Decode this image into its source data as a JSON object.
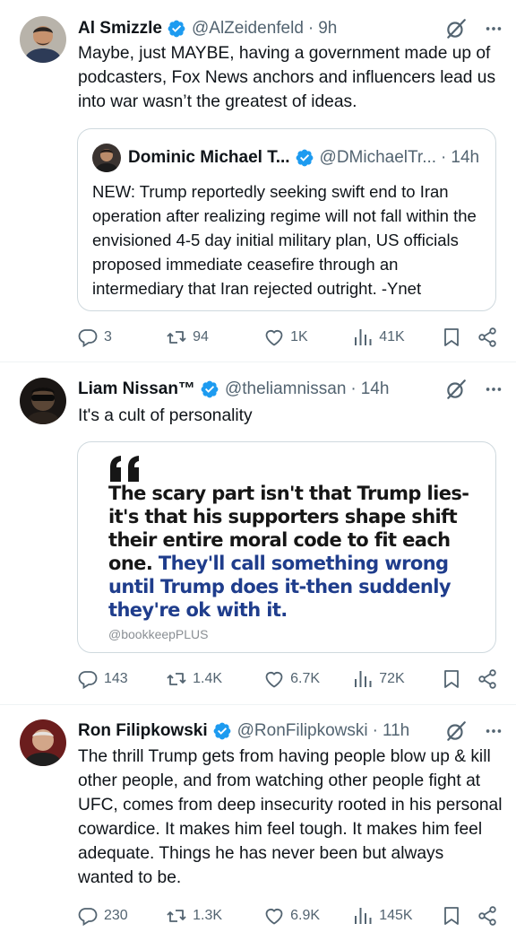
{
  "tweets": [
    {
      "name": "Al Smizzle",
      "handle": "@AlZeidenfeld",
      "time": "9h",
      "text": "Maybe, just MAYBE, having a government made up of podcasters, Fox News anchors and influencers lead us into war wasn’t the greatest of ideas.",
      "quote": {
        "name": "Dominic Michael T...",
        "handle": "@DMichaelTr...",
        "time": "14h",
        "text": "NEW: Trump reportedly seeking swift end to Iran operation after realizing regime will not fall within the envisioned 4-5 day initial military plan, US officials proposed immediate ceasefire through an intermediary that Iran rejected outright. -Ynet"
      },
      "replies": "3",
      "reposts": "94",
      "likes": "1K",
      "views": "41K"
    },
    {
      "name": "Liam Nissan™",
      "handle": "@theliamnissan",
      "time": "14h",
      "text": "It's a cult of personality",
      "card": {
        "line_dark": "The scary part isn't that Trump lies-it's that his supporters shape shift their entire moral code to fit each one.",
        "line_blue": "They'll call something wrong until Trump does it-then suddenly they're ok with it.",
        "credit": "@bookkeepPLUS"
      },
      "replies": "143",
      "reposts": "1.4K",
      "likes": "6.7K",
      "views": "72K"
    },
    {
      "name": "Ron Filipkowski",
      "handle": "@RonFilipkowski",
      "time": "11h",
      "text": "The thrill Trump gets from having people blow up & kill other people, and from watching other people fight at UFC, comes from deep insecurity rooted in his personal cowardice. It makes him feel tough. It makes him feel adequate. Things he has never been but always wanted to be.",
      "replies": "230",
      "reposts": "1.3K",
      "likes": "6.9K",
      "views": "145K"
    }
  ],
  "separator": "·",
  "colors": {
    "verified": "#1d9bf0",
    "secondary": "#536471",
    "card_blue": "#1f3d8c"
  },
  "icons": [
    "verified-badge-icon",
    "grok-icon",
    "more-icon",
    "reply-icon",
    "repost-icon",
    "like-icon",
    "views-icon",
    "bookmark-icon",
    "share-icon"
  ]
}
